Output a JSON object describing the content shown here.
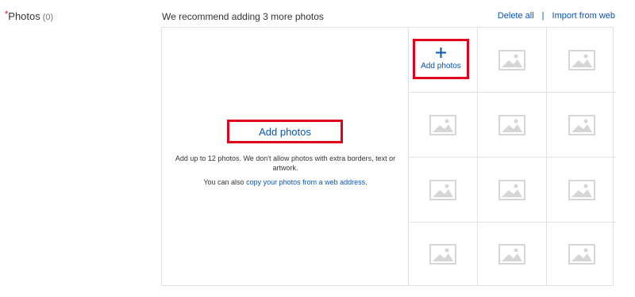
{
  "field": {
    "required_mark": "*",
    "label": "Photos",
    "count": "(0)"
  },
  "recommendation": "We recommend adding 3 more photos",
  "links": {
    "delete_all": "Delete all",
    "separator": "|",
    "import_from_web": "Import from web"
  },
  "main_panel": {
    "add_button": "Add photos",
    "info_text": "Add up to 12 photos. We don't allow photos with extra borders, text or artwork.",
    "web_prefix": "You can also ",
    "web_link": "copy your photos from a web address",
    "web_suffix": "."
  },
  "first_slot": {
    "icon": "plus-icon",
    "label": "Add photos"
  },
  "placeholder_icon": "image-placeholder-icon",
  "colors": {
    "link": "#0654ba",
    "highlight": "#e0001b",
    "border": "#e1e1e1",
    "placeholder": "#d6d6d6"
  }
}
